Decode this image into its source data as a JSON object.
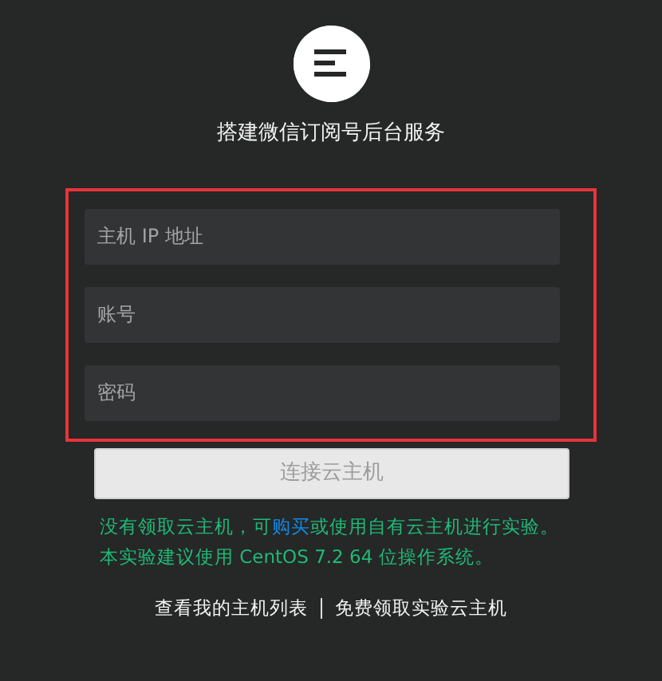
{
  "title": "搭建微信订阅号后台服务",
  "fields": [
    {
      "placeholder": "主机 IP 地址"
    },
    {
      "placeholder": "账号"
    },
    {
      "placeholder": "密码"
    }
  ],
  "highlighted": true,
  "connect_button": {
    "label": "连接云主机",
    "disabled": true
  },
  "notice": {
    "before": "没有领取云主机，可",
    "link": "购买",
    "after": "或使用自有云主机进行实验。本实验建议使用 CentOS 7.2 64 位操作系统。"
  },
  "footer_links": [
    "查看我的主机列表",
    "免费领取实验云主机"
  ]
}
